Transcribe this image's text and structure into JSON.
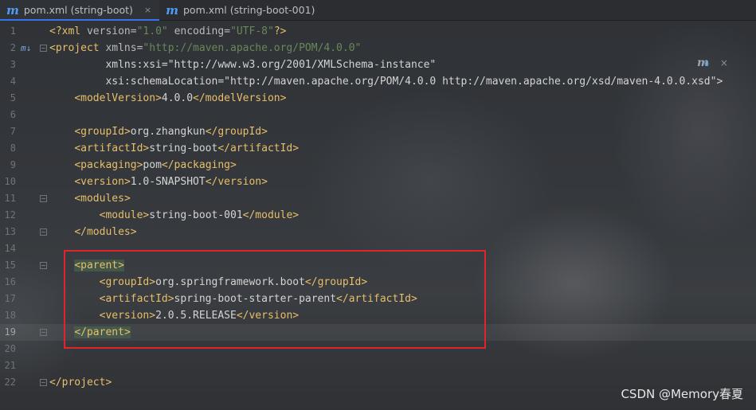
{
  "tabs": [
    {
      "icon": "maven-file-icon",
      "glyph": "m",
      "label": "pom.xml (string-boot)",
      "active": true
    },
    {
      "icon": "maven-file-icon",
      "glyph": "m",
      "label": "pom.xml (string-boot-001)",
      "active": false
    }
  ],
  "close_glyph": "×",
  "editor": {
    "current_line": 19,
    "lines": [
      {
        "n": "1",
        "code": "<?xml version=\"1.0\" encoding=\"UTF-8\"?>"
      },
      {
        "n": "2",
        "code": "<project xmlns=\"http://maven.apache.org/POM/4.0.0\""
      },
      {
        "n": "3",
        "code": "         xmlns:xsi=\"http://www.w3.org/2001/XMLSchema-instance\""
      },
      {
        "n": "4",
        "code": "         xsi:schemaLocation=\"http://maven.apache.org/POM/4.0.0 http://maven.apache.org/xsd/maven-4.0.0.xsd\">"
      },
      {
        "n": "5",
        "code": "    <modelVersion>4.0.0</modelVersion>"
      },
      {
        "n": "6",
        "code": ""
      },
      {
        "n": "7",
        "code": "    <groupId>org.zhangkun</groupId>"
      },
      {
        "n": "8",
        "code": "    <artifactId>string-boot</artifactId>"
      },
      {
        "n": "9",
        "code": "    <packaging>pom</packaging>"
      },
      {
        "n": "10",
        "code": "    <version>1.0-SNAPSHOT</version>"
      },
      {
        "n": "11",
        "code": "    <modules>"
      },
      {
        "n": "12",
        "code": "        <module>string-boot-001</module>"
      },
      {
        "n": "13",
        "code": "    </modules>"
      },
      {
        "n": "14",
        "code": ""
      },
      {
        "n": "15",
        "code": "    <parent>"
      },
      {
        "n": "16",
        "code": "        <groupId>org.springframework.boot</groupId>"
      },
      {
        "n": "17",
        "code": "        <artifactId>spring-boot-starter-parent</artifactId>"
      },
      {
        "n": "18",
        "code": "        <version>2.0.5.RELEASE</version>"
      },
      {
        "n": "19",
        "code": "    </parent>"
      },
      {
        "n": "20",
        "code": ""
      },
      {
        "n": "21",
        "code": ""
      },
      {
        "n": "22",
        "code": "</project>"
      }
    ]
  },
  "maven_popup": {
    "icon": "maven-reload-icon",
    "glyph": "m",
    "close": "×"
  },
  "watermark": "CSDN @Memory春夏",
  "colors": {
    "highlight_box": "#e0232d",
    "tag": "#e8bf6a",
    "string": "#6a8759",
    "namespace": "#9876aa"
  }
}
